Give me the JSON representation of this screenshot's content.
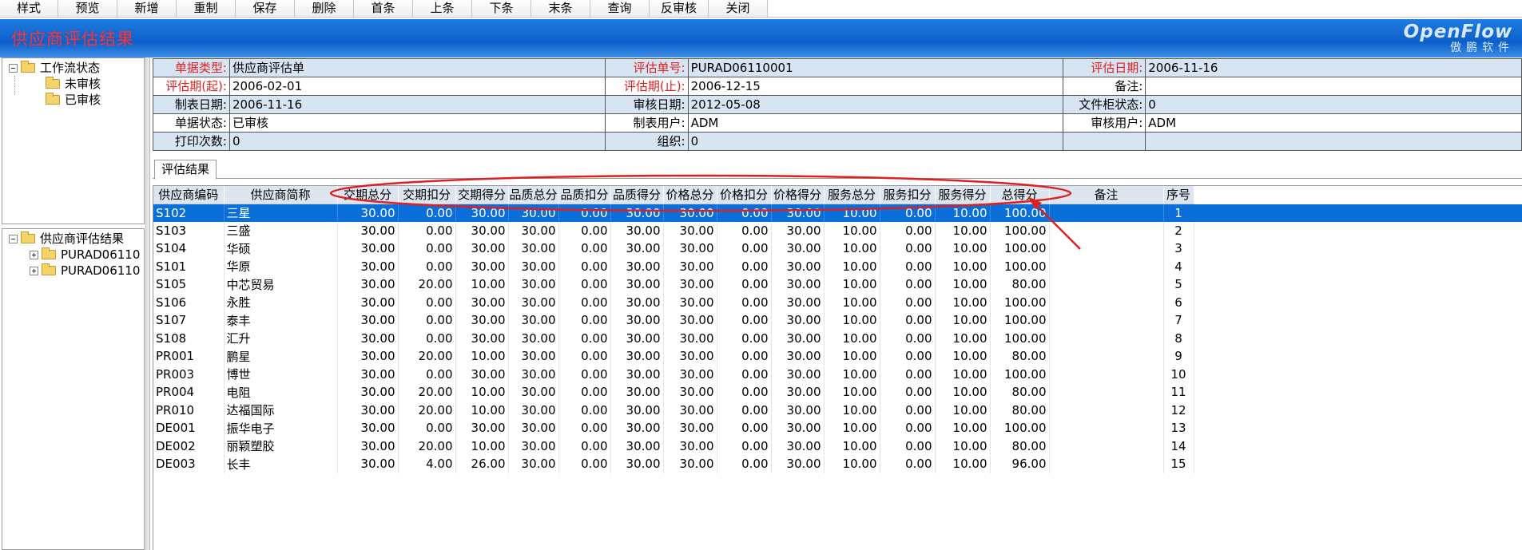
{
  "toolbar": {
    "buttons": [
      "样式",
      "预览",
      "新增",
      "重制",
      "保存",
      "删除",
      "首条",
      "上条",
      "下条",
      "末条",
      "查询",
      "反审核",
      "关闭"
    ]
  },
  "header": {
    "title": "供应商评估结果",
    "logo_line1": "OpenFlow",
    "logo_line2": "傲鹏软件"
  },
  "tree_top": {
    "root": "工作流状态",
    "children": [
      "未审核",
      "已审核"
    ]
  },
  "tree_bottom": {
    "root": "供应商评估结果",
    "children": [
      "PURAD06110",
      "PURAD06110"
    ]
  },
  "form": {
    "rows": [
      [
        [
          "单据类型:",
          "供应商评估单",
          true
        ],
        [
          "评估单号:",
          "PURAD06110001",
          true
        ],
        [
          "评估日期:",
          "2006-11-16",
          true
        ]
      ],
      [
        [
          "评估期(起):",
          "2006-02-01",
          true
        ],
        [
          "评估期(止):",
          "2006-12-15",
          true
        ],
        [
          "备注:",
          "",
          false
        ]
      ],
      [
        [
          "制表日期:",
          "2006-11-16",
          false
        ],
        [
          "审核日期:",
          "2012-05-08",
          false
        ],
        [
          "文件柜状态:",
          "0",
          false
        ]
      ],
      [
        [
          "单据状态:",
          "已审核",
          false
        ],
        [
          "制表用户:",
          "ADM",
          false
        ],
        [
          "审核用户:",
          "ADM",
          false
        ]
      ],
      [
        [
          "打印次数:",
          "0",
          false
        ],
        [
          "组织:",
          "0",
          false
        ],
        [
          "",
          ""
        ]
      ]
    ]
  },
  "tab": {
    "label": "评估结果"
  },
  "grid": {
    "columns": [
      "供应商编码",
      "供应商简称",
      "交期总分",
      "交期扣分",
      "交期得分",
      "品质总分",
      "品质扣分",
      "品质得分",
      "价格总分",
      "价格扣分",
      "价格得分",
      "服务总分",
      "服务扣分",
      "服务得分",
      "总得分",
      "备注",
      "序号"
    ],
    "rows": [
      [
        "S102",
        "三星",
        "30.00",
        "0.00",
        "30.00",
        "30.00",
        "0.00",
        "30.00",
        "30.00",
        "0.00",
        "30.00",
        "10.00",
        "0.00",
        "10.00",
        "100.00",
        "",
        "1"
      ],
      [
        "S103",
        "三盛",
        "30.00",
        "0.00",
        "30.00",
        "30.00",
        "0.00",
        "30.00",
        "30.00",
        "0.00",
        "30.00",
        "10.00",
        "0.00",
        "10.00",
        "100.00",
        "",
        "2"
      ],
      [
        "S104",
        "华硕",
        "30.00",
        "0.00",
        "30.00",
        "30.00",
        "0.00",
        "30.00",
        "30.00",
        "0.00",
        "30.00",
        "10.00",
        "0.00",
        "10.00",
        "100.00",
        "",
        "3"
      ],
      [
        "S101",
        "华原",
        "30.00",
        "0.00",
        "30.00",
        "30.00",
        "0.00",
        "30.00",
        "30.00",
        "0.00",
        "30.00",
        "10.00",
        "0.00",
        "10.00",
        "100.00",
        "",
        "4"
      ],
      [
        "S105",
        "中芯贸易",
        "30.00",
        "20.00",
        "10.00",
        "30.00",
        "0.00",
        "30.00",
        "30.00",
        "0.00",
        "30.00",
        "10.00",
        "0.00",
        "10.00",
        "80.00",
        "",
        "5"
      ],
      [
        "S106",
        "永胜",
        "30.00",
        "0.00",
        "30.00",
        "30.00",
        "0.00",
        "30.00",
        "30.00",
        "0.00",
        "30.00",
        "10.00",
        "0.00",
        "10.00",
        "100.00",
        "",
        "6"
      ],
      [
        "S107",
        "泰丰",
        "30.00",
        "0.00",
        "30.00",
        "30.00",
        "0.00",
        "30.00",
        "30.00",
        "0.00",
        "30.00",
        "10.00",
        "0.00",
        "10.00",
        "100.00",
        "",
        "7"
      ],
      [
        "S108",
        "汇升",
        "30.00",
        "0.00",
        "30.00",
        "30.00",
        "0.00",
        "30.00",
        "30.00",
        "0.00",
        "30.00",
        "10.00",
        "0.00",
        "10.00",
        "100.00",
        "",
        "8"
      ],
      [
        "PR001",
        "鹏星",
        "30.00",
        "20.00",
        "10.00",
        "30.00",
        "0.00",
        "30.00",
        "30.00",
        "0.00",
        "30.00",
        "10.00",
        "0.00",
        "10.00",
        "80.00",
        "",
        "9"
      ],
      [
        "PR003",
        "博世",
        "30.00",
        "0.00",
        "30.00",
        "30.00",
        "0.00",
        "30.00",
        "30.00",
        "0.00",
        "30.00",
        "10.00",
        "0.00",
        "10.00",
        "100.00",
        "",
        "10"
      ],
      [
        "PR004",
        "电阻",
        "30.00",
        "20.00",
        "10.00",
        "30.00",
        "0.00",
        "30.00",
        "30.00",
        "0.00",
        "30.00",
        "10.00",
        "0.00",
        "10.00",
        "80.00",
        "",
        "11"
      ],
      [
        "PR010",
        "达福国际",
        "30.00",
        "20.00",
        "10.00",
        "30.00",
        "0.00",
        "30.00",
        "30.00",
        "0.00",
        "30.00",
        "10.00",
        "0.00",
        "10.00",
        "80.00",
        "",
        "12"
      ],
      [
        "DE001",
        "振华电子",
        "30.00",
        "0.00",
        "30.00",
        "30.00",
        "0.00",
        "30.00",
        "30.00",
        "0.00",
        "30.00",
        "10.00",
        "0.00",
        "10.00",
        "100.00",
        "",
        "13"
      ],
      [
        "DE002",
        "丽颖塑胶",
        "30.00",
        "20.00",
        "10.00",
        "30.00",
        "0.00",
        "30.00",
        "30.00",
        "0.00",
        "30.00",
        "10.00",
        "0.00",
        "10.00",
        "80.00",
        "",
        "14"
      ],
      [
        "DE003",
        "长丰",
        "30.00",
        "4.00",
        "26.00",
        "30.00",
        "0.00",
        "30.00",
        "30.00",
        "0.00",
        "30.00",
        "10.00",
        "0.00",
        "10.00",
        "96.00",
        "",
        "15"
      ]
    ],
    "selected_row": 0
  },
  "colors": {
    "title_bar": "#0b5fc9",
    "title_text": "#ff3030",
    "selection": "#0a6fd9",
    "annotation": "#e02020",
    "form_alt_row": "#d7e4f2"
  }
}
